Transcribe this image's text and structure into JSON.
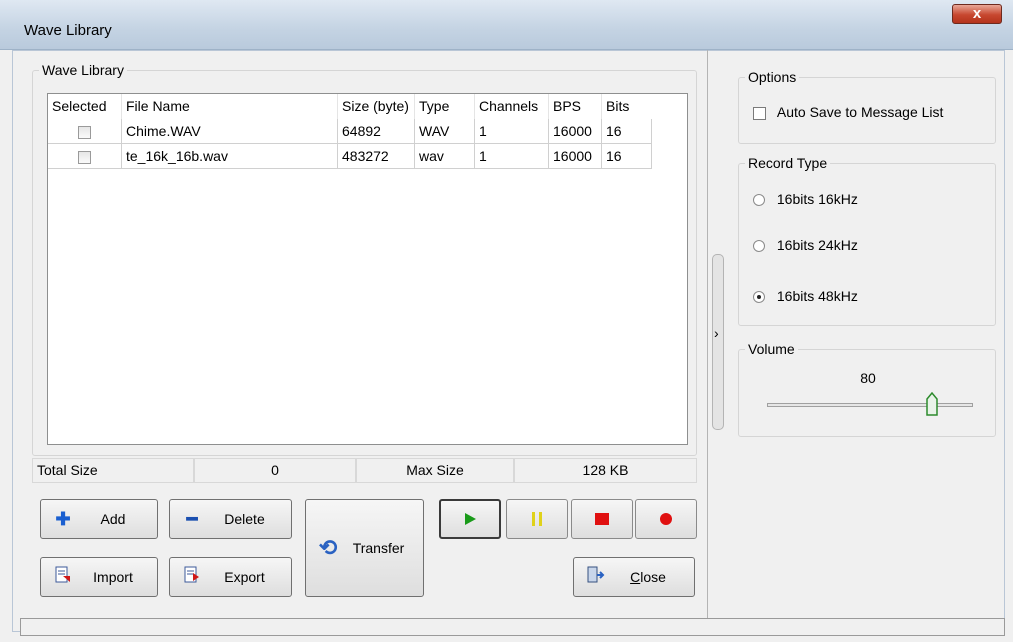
{
  "window": {
    "title": "Wave Library",
    "close_glyph": "x"
  },
  "library": {
    "group_label": "Wave Library",
    "columns": [
      "Selected",
      "File Name",
      "Size (byte)",
      "Type",
      "Channels",
      "BPS",
      "Bits"
    ],
    "rows": [
      {
        "selected": false,
        "name": "Chime.WAV",
        "size": "64892",
        "type": "WAV",
        "channels": "1",
        "bps": "16000",
        "bits": "16"
      },
      {
        "selected": false,
        "name": "te_16k_16b.wav",
        "size": "483272",
        "type": "wav",
        "channels": "1",
        "bps": "16000",
        "bits": "16"
      }
    ]
  },
  "status": {
    "total_label": "Total Size",
    "total_value": "0",
    "max_label": "Max Size",
    "max_value": "128 KB"
  },
  "buttons": {
    "add": "Add",
    "delete": "Delete",
    "import": "Import",
    "export": "Export",
    "transfer": "Transfer",
    "close_prefix": "",
    "close_underline": "C",
    "close_rest": "lose"
  },
  "media": {
    "play": "play-icon",
    "pause": "pause-icon",
    "stop": "stop-icon",
    "record": "record-icon"
  },
  "options": {
    "group_label": "Options",
    "auto_save": "Auto Save to Message List",
    "auto_save_checked": false
  },
  "record_type": {
    "group_label": "Record Type",
    "items": [
      {
        "label": "16bits 16kHz",
        "selected": false
      },
      {
        "label": "16bits 24kHz",
        "selected": false
      },
      {
        "label": "16bits 48kHz",
        "selected": true
      }
    ]
  },
  "volume": {
    "group_label": "Volume",
    "value": "80",
    "level": 80,
    "max": 100
  },
  "splitter": {
    "glyph": "›"
  },
  "colors": {
    "play": "#1a9b1a",
    "pause": "#e0d21a",
    "stop": "#e01010",
    "record": "#e01010",
    "add": "#1a5fd0",
    "delete": "#1a4fb0"
  }
}
